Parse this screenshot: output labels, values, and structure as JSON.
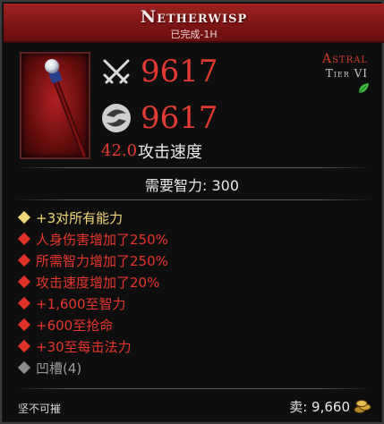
{
  "item": {
    "name": "Netherwisp",
    "subtitle": "已完成-1H",
    "rarity": "Astral",
    "tier": "Tier VI"
  },
  "stats": {
    "damage": "9617",
    "defense": "9617",
    "attack_speed_value": "42.0",
    "attack_speed_label": "攻击速度"
  },
  "requirement": "需要智力: 300",
  "affixes": [
    {
      "text": "+3对所有能力",
      "style": "gold"
    },
    {
      "text": "人身伤害增加了250%",
      "style": "red"
    },
    {
      "text": "所需智力增加了250%",
      "style": "red"
    },
    {
      "text": "攻击速度增加了20%",
      "style": "red"
    },
    {
      "text": "+1,600至智力",
      "style": "red"
    },
    {
      "text": "+600至抢命",
      "style": "red"
    },
    {
      "text": "+30至每击法力",
      "style": "red"
    },
    {
      "text": "凹槽(4)",
      "style": "grey"
    }
  ],
  "footer": {
    "durability": "坚不可摧",
    "sell_label": "卖: 9,660"
  },
  "icons": {
    "damage": "crossed-swords-icon",
    "defense": "swirl-shield-icon",
    "leaf": "leaf-icon",
    "gold": "gold-coins-icon"
  },
  "colors": {
    "header": "#8c1a19",
    "damage_red": "#e23b32",
    "gold_affix": "#f0d77a",
    "red_affix": "#e6352d"
  }
}
